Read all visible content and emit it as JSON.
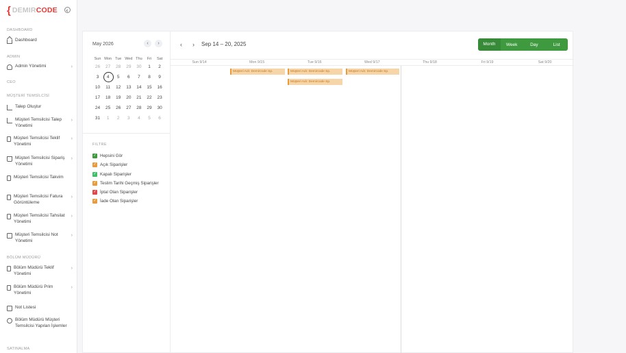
{
  "brand": {
    "demir": "DEMIR",
    "code": "CODE"
  },
  "sidebar": {
    "sections": {
      "dashboard": "DASHBOARD",
      "admin": "ADMIN",
      "ceo": "CEO",
      "musteri": "MÜŞTERİ TEMSİLCİSİ",
      "bolum": "BÖLÜM MÜDÜRÜ",
      "satinalma": "SATINALMA"
    },
    "items": [
      {
        "label": "Dashboard"
      },
      {
        "label": "Admin Yönetimi"
      },
      {
        "label": "Talep Oluştur"
      },
      {
        "label": "Müşteri Temsilcisi Talep Yönetimi"
      },
      {
        "label": "Müşteri Temsilcisi Teklif Yönetimi"
      },
      {
        "label": "Müşteri Temsilcisi Sipariş Yönetimi"
      },
      {
        "label": "Müşteri Temsilcisi Takvim"
      },
      {
        "label": "Müşteri Temsilcisi Fatura Görüntüleme"
      },
      {
        "label": "Müşteri Temsilcisi Tahsilat Yönetimi"
      },
      {
        "label": "Müşteri Temsilcisi Not Yönetimi"
      },
      {
        "label": "Bölüm Müdürü Teklif Yönetimi"
      },
      {
        "label": "Bölüm Müdürü Prim Yönetimi"
      },
      {
        "label": "Not Listesi"
      },
      {
        "label": "Bölüm Müdürü Müşteri Temsilcisi Yapılan İşlemler"
      }
    ]
  },
  "mini_calendar": {
    "title": "May 2026",
    "prev": "‹",
    "next": "›",
    "weekdays": [
      "Sun",
      "Mon",
      "Tue",
      "Wed",
      "Thu",
      "Fri",
      "Sat"
    ],
    "weeks": [
      [
        "26",
        "27",
        "28",
        "29",
        "30",
        "1",
        "2"
      ],
      [
        "3",
        "4",
        "5",
        "6",
        "7",
        "8",
        "9"
      ],
      [
        "10",
        "11",
        "12",
        "13",
        "14",
        "15",
        "16"
      ],
      [
        "17",
        "18",
        "19",
        "20",
        "21",
        "22",
        "23"
      ],
      [
        "24",
        "25",
        "26",
        "27",
        "28",
        "29",
        "30"
      ],
      [
        "31",
        "1",
        "2",
        "3",
        "4",
        "5",
        "6"
      ]
    ]
  },
  "filters": {
    "title": "FILTRE",
    "items": [
      {
        "label": "Hepsini Gör",
        "color": "#3f9a3f"
      },
      {
        "label": "Açık Siparişler",
        "color": "#e79b3c"
      },
      {
        "label": "Kapalı Siparişler",
        "color": "#3fbf6a"
      },
      {
        "label": "Teslim Tarihi Geçmiş Siparişler",
        "color": "#e79b3c"
      },
      {
        "label": "İptal Olan Siparişler",
        "color": "#e04848"
      },
      {
        "label": "İade Olan Siparişler",
        "color": "#e79b3c"
      }
    ]
  },
  "calendar": {
    "prev": "‹",
    "next": "›",
    "range": "Sep 14 – 20, 2025",
    "views": [
      "Month",
      "Week",
      "Day",
      "List"
    ],
    "days": [
      "Sun 9/14",
      "Mon 9/15",
      "Tue 9/16",
      "Wed 9/17",
      "Thu 9/18",
      "Fri 9/19",
      "Sat 9/20"
    ],
    "events": [
      {
        "label": "Müşteri Adı: Demircode Sp."
      },
      {
        "label": "Müşteri Adı: Demircode Sp."
      },
      {
        "label": "Müşteri Adı: Demircode Sp."
      },
      {
        "label": "Müşteri Adı: Demircode Sp."
      }
    ]
  }
}
